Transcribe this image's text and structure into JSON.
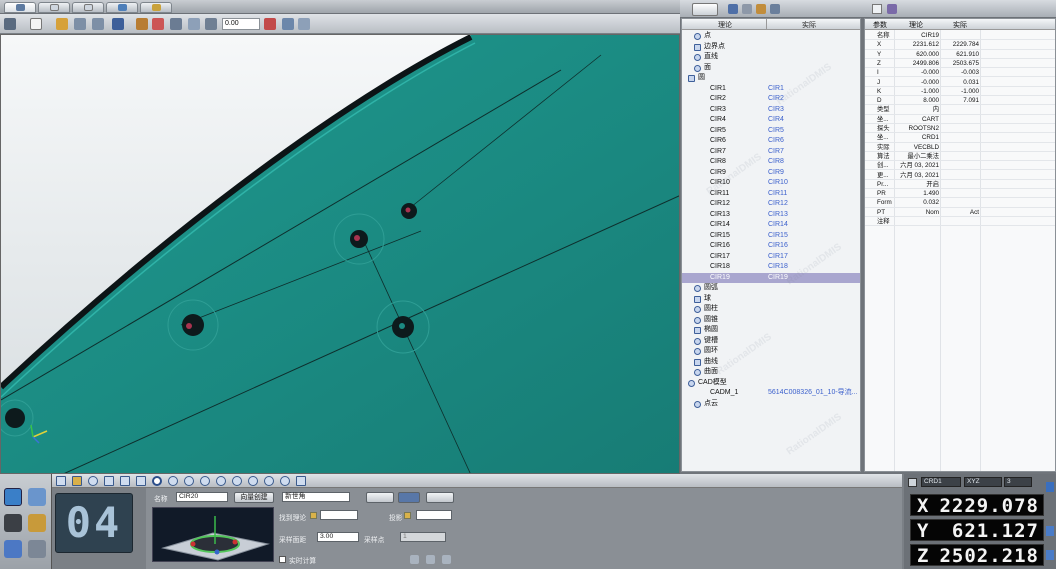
{
  "toolbar": {
    "zoom_value": "0.00"
  },
  "tree": {
    "col_nominal": "理论",
    "col_actual": "实际",
    "items": [
      {
        "label": "点",
        "actual": "",
        "icon": "point-icon",
        "indent": 1
      },
      {
        "label": "边界点",
        "actual": "",
        "icon": "edge-point-icon",
        "indent": 1
      },
      {
        "label": "直线",
        "actual": "",
        "icon": "line-icon",
        "indent": 1
      },
      {
        "label": "面",
        "actual": "",
        "icon": "plane-icon",
        "indent": 1
      },
      {
        "label": "圆",
        "actual": "",
        "icon": "circle-icon",
        "indent": 0
      },
      {
        "label": "CIR1",
        "actual": "CIR1",
        "indent": 2
      },
      {
        "label": "CIR2",
        "actual": "CIR2",
        "indent": 2
      },
      {
        "label": "CIR3",
        "actual": "CIR3",
        "indent": 2
      },
      {
        "label": "CIR4",
        "actual": "CIR4",
        "indent": 2
      },
      {
        "label": "CIR5",
        "actual": "CIR5",
        "indent": 2
      },
      {
        "label": "CIR6",
        "actual": "CIR6",
        "indent": 2
      },
      {
        "label": "CIR7",
        "actual": "CIR7",
        "indent": 2
      },
      {
        "label": "CIR8",
        "actual": "CIR8",
        "indent": 2
      },
      {
        "label": "CIR9",
        "actual": "CIR9",
        "indent": 2
      },
      {
        "label": "CIR10",
        "actual": "CIR10",
        "indent": 2
      },
      {
        "label": "CIR11",
        "actual": "CIR11",
        "indent": 2
      },
      {
        "label": "CIR12",
        "actual": "CIR12",
        "indent": 2
      },
      {
        "label": "CIR13",
        "actual": "CIR13",
        "indent": 2
      },
      {
        "label": "CIR14",
        "actual": "CIR14",
        "indent": 2
      },
      {
        "label": "CIR15",
        "actual": "CIR15",
        "indent": 2
      },
      {
        "label": "CIR16",
        "actual": "CIR16",
        "indent": 2
      },
      {
        "label": "CIR17",
        "actual": "CIR17",
        "indent": 2
      },
      {
        "label": "CIR18",
        "actual": "CIR18",
        "indent": 2
      },
      {
        "label": "CIR19",
        "actual": "CIR19",
        "indent": 2,
        "selected": true
      },
      {
        "label": "圆弧",
        "actual": "",
        "icon": "arc-icon",
        "indent": 1
      },
      {
        "label": "球",
        "actual": "",
        "icon": "sphere-icon",
        "indent": 1
      },
      {
        "label": "圆柱",
        "actual": "",
        "icon": "cylinder-icon",
        "indent": 1
      },
      {
        "label": "圆锥",
        "actual": "",
        "icon": "cone-icon",
        "indent": 1
      },
      {
        "label": "椭圆",
        "actual": "",
        "icon": "ellipse-icon",
        "indent": 1
      },
      {
        "label": "键槽",
        "actual": "",
        "icon": "slot-icon",
        "indent": 1
      },
      {
        "label": "圆环",
        "actual": "",
        "icon": "torus-icon",
        "indent": 1
      },
      {
        "label": "曲线",
        "actual": "",
        "icon": "curve-icon",
        "indent": 1
      },
      {
        "label": "曲面",
        "actual": "",
        "icon": "surface-icon",
        "indent": 1
      },
      {
        "label": "CAD模型",
        "actual": "",
        "icon": "cad-icon",
        "indent": 0
      },
      {
        "label": "CADM_1",
        "actual": "5614C008326_01_10-导流...",
        "indent": 2
      },
      {
        "label": "点云",
        "actual": "",
        "icon": "point-cloud-icon",
        "indent": 1
      }
    ]
  },
  "props": {
    "col_param": "参数",
    "col_nominal": "理论",
    "col_actual": "实际",
    "rows": [
      {
        "param": "名称",
        "nominal": "CIR19",
        "actual": ""
      },
      {
        "param": "X",
        "nominal": "2231.612",
        "actual": "2229.784"
      },
      {
        "param": "Y",
        "nominal": "620.000",
        "actual": "621.910"
      },
      {
        "param": "Z",
        "nominal": "2499.806",
        "actual": "2503.675"
      },
      {
        "param": "I",
        "nominal": "-0.000",
        "actual": "-0.003"
      },
      {
        "param": "J",
        "nominal": "-0.000",
        "actual": "0.031"
      },
      {
        "param": "K",
        "nominal": "-1.000",
        "actual": "-1.000"
      },
      {
        "param": "D",
        "nominal": "8.000",
        "actual": "7.091"
      },
      {
        "param": "类型",
        "nominal": "内",
        "actual": ""
      },
      {
        "param": "坐...",
        "nominal": "CART",
        "actual": ""
      },
      {
        "param": "探头",
        "nominal": "ROOTSN2",
        "actual": ""
      },
      {
        "param": "坐...",
        "nominal": "CRD1",
        "actual": ""
      },
      {
        "param": "实际",
        "nominal": "VECBLD",
        "actual": ""
      },
      {
        "param": "算法",
        "nominal": "最小二乘法",
        "actual": ""
      },
      {
        "param": "创...",
        "nominal": "六月 03, 2021",
        "actual": ""
      },
      {
        "param": "更...",
        "nominal": "六月 03, 2021",
        "actual": ""
      },
      {
        "param": "Pr...",
        "nominal": "开启",
        "actual": ""
      },
      {
        "param": "PR",
        "nominal": "1.490",
        "actual": ""
      },
      {
        "param": "Form",
        "nominal": "0.032",
        "actual": ""
      },
      {
        "param": "PT",
        "nominal": "Nom",
        "actual": "Act"
      },
      {
        "param": "注释",
        "nominal": "",
        "actual": ""
      }
    ]
  },
  "feature_form": {
    "lcd_value": "04",
    "name_label": "名称",
    "name_value": "CIR20",
    "direction_button": "向量创建",
    "type_select": "新世角",
    "capture_nominal_label": "找到理论",
    "projection_label": "投影",
    "sample_distance_label": "采样面距",
    "sample_distance_value": "3.00",
    "sample_points_label": "采样点",
    "sample_points_value": "1",
    "realtime_calc_label": "实时计算"
  },
  "dro": {
    "coord_system": "CRD1",
    "mode": "XYZ",
    "digits": "3",
    "axes": [
      {
        "axis": "X",
        "value": "2229.078"
      },
      {
        "axis": "Y",
        "value": "621.127"
      },
      {
        "axis": "Z",
        "value": "2502.218"
      }
    ]
  },
  "colors": {
    "surface_teal": "#1b8b83",
    "selection": "#a9a6cf",
    "actual_blue": "#3a5fcc"
  }
}
